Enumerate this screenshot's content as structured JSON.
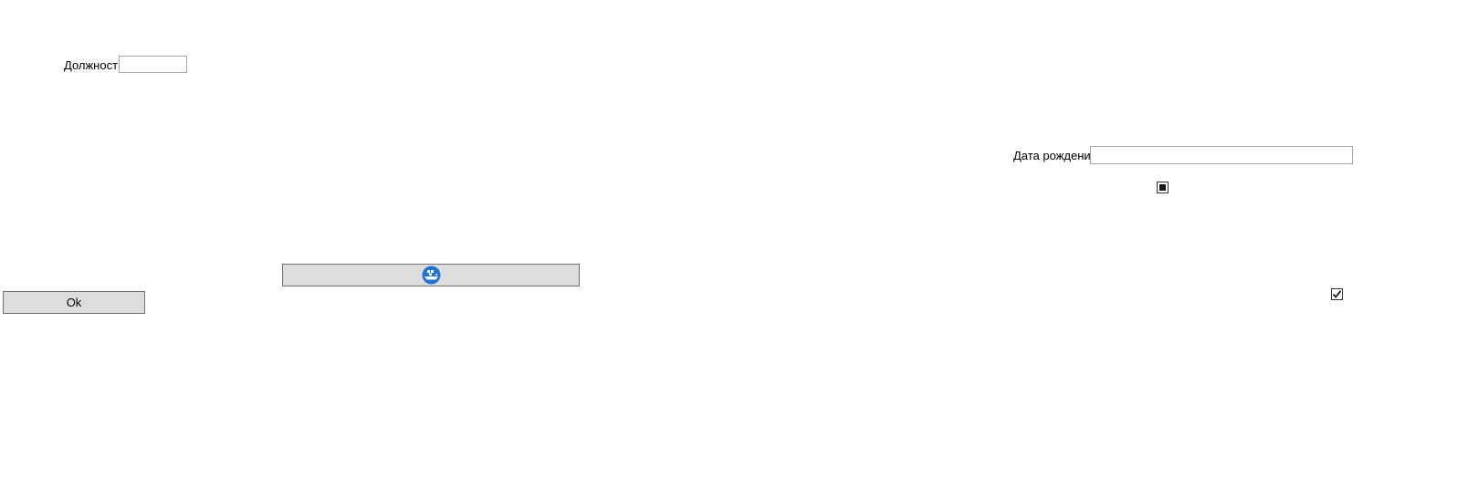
{
  "form": {
    "position_label": "Должность",
    "position_value": "",
    "birthdate_label": "Дата рождения",
    "birthdate_value": "",
    "ok_button_label": "Ok",
    "icon_button_icon": "ship-icon",
    "indeterminate_check_state": "indeterminate",
    "checkbox_state": "checked"
  },
  "colors": {
    "background": "#ffffff",
    "button_face": "#dddddd",
    "button_border": "#707070",
    "textbox_border": "#a8a8a8",
    "icon_blue": "#1e73d8"
  }
}
